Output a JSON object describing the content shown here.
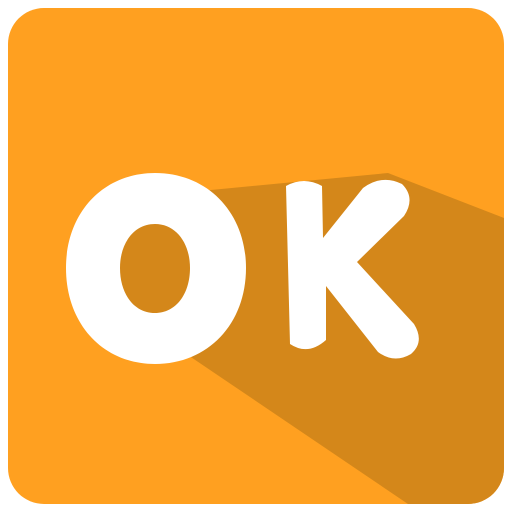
{
  "icon": {
    "text": "OK",
    "background_color": "#FFA020",
    "shadow_color": "#D4871A",
    "letter_color": "#FFFFFF"
  }
}
